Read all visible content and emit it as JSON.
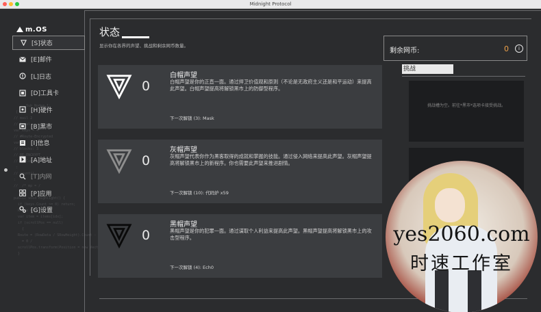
{
  "window": {
    "title": "Midnight Protocol"
  },
  "colors": {
    "accent": "#f0a24a",
    "panel": "#3b3d40",
    "background": "#2b2c2e"
  },
  "logo": {
    "text": "m.OS"
  },
  "background_code": "        Sub Node=-1;\n   {\n  // mail 2\n  // local\n  var keys = 4\n  // #Route-Encrypted\n  var\n  // blocks: 3\n  // RE-ENCRYPT\n  // #a Content loop\n   :\n  // count()\n  :\n  //  /* mp = /\n\n  public void Highlight() {\n    if (keys.Count >= 0) return;\n    Route = 0;\n    var item = items[idx];\n    if (scrollPos == null)\n      {\n    Route = (RowData / SRowHeight).Count - To\n      = 0 /\n    scrollPos.transform(Position = new Vector2(0, 0)\n    }",
  "sidebar": {
    "items": [
      {
        "label": "[S]状态",
        "icon": "triangle-icon"
      },
      {
        "label": "[E]邮件",
        "icon": "mail-icon"
      },
      {
        "label": "[L]日志",
        "icon": "log-icon"
      },
      {
        "label": "[D]工具卡",
        "icon": "card-icon"
      },
      {
        "label": "[H]硬件",
        "icon": "hardware-icon"
      },
      {
        "label": "[B]黑市",
        "icon": "market-icon"
      },
      {
        "label": "[I]信息",
        "icon": "info-icon"
      },
      {
        "label": "[A]地址",
        "icon": "address-icon"
      },
      {
        "label": "[T]内网",
        "icon": "search-icon"
      },
      {
        "label": "[P]应用",
        "icon": "apps-icon"
      },
      {
        "label": "[G]设置",
        "icon": "gear-icon"
      }
    ]
  },
  "main": {
    "title": "状态",
    "subtitle": "显示你在各界的声望、挑战和剩余网币数量。",
    "reputations": [
      {
        "name": "白帽声望",
        "value": "0",
        "description": "白帽声望是你的正直一面。通过捍卫价值观和原则（不论是无政府主义还是和平运动）来提高此声望。白帽声望提高将解锁黑市上的防御型程序。",
        "unlock": "下一次解锁 (3): Mask",
        "mark_color": "#ffffff"
      },
      {
        "name": "灰帽声望",
        "value": "0",
        "description": "灰帽声望代表你作为黑客取得的成就和掌握的技能。通过侵入网络来提高此声望。灰帽声望提高将解锁黑市上的新程序。你也需要此声望来推进剧情。",
        "unlock": "下一次解锁 (10): 代码炉 x59",
        "mark_color": "#8e8e8e"
      },
      {
        "name": "黑帽声望",
        "value": "0",
        "description": "黑帽声望是你的犯罪一面。通过谋取个人利益来提高此声望。黑帽声望提高将解锁黑市上的攻击型程序。",
        "unlock": "下一次解锁 (4): Ech0",
        "mark_color": "#0a0a0a"
      }
    ]
  },
  "currency": {
    "label": "剩余网币:",
    "value": "0",
    "info_icon": "info-circle-icon"
  },
  "challenges": {
    "title": "挑战",
    "empty_text": "挑战槽为空。前往*黑市*选项卡接受挑战。"
  },
  "watermark": {
    "line1": "yes2060.com",
    "line2": "时速工作室"
  }
}
